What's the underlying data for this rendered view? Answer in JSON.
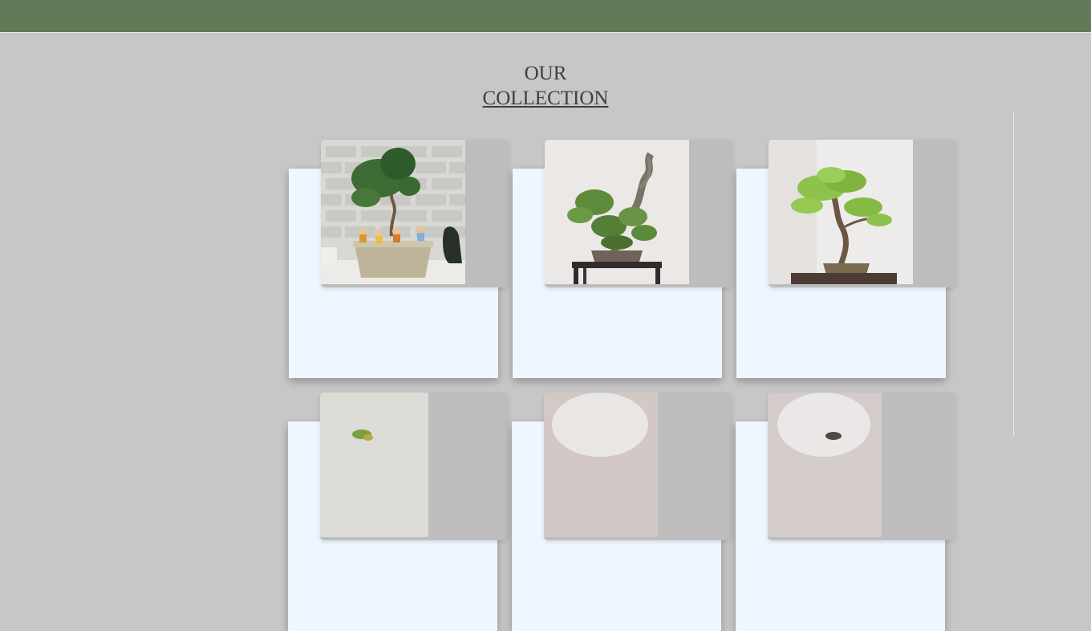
{
  "heading": {
    "line1": "OUR",
    "line2": "COLLECTION"
  },
  "colors": {
    "topbar": "#637a58",
    "page_bg": "#c7c7c7",
    "card_bg": "#eef6ff"
  },
  "products": [
    {
      "image": "bonsai-brick-wall-monk-figurines-photo"
    },
    {
      "image": "bonsai-driftwood-on-stand-photo"
    },
    {
      "image": "bonsai-maple-on-wood-slab-photo"
    },
    {
      "image": "bonsai-photo"
    },
    {
      "image": "bonsai-photo"
    },
    {
      "image": "bonsai-photo"
    }
  ]
}
